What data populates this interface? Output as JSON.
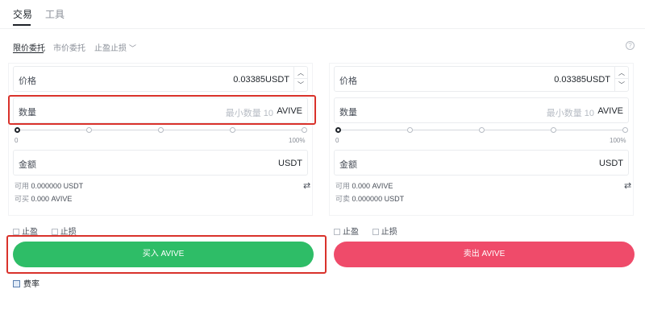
{
  "top_tabs": [
    {
      "label": "交易",
      "active": true
    },
    {
      "label": "工具",
      "active": false
    }
  ],
  "order_tabs": {
    "limit": "限价委托",
    "market": "市价委托",
    "tpsl": "止盈止损",
    "tpsl_chevron": "﹀",
    "help": "?"
  },
  "buy_panel": {
    "price_label": "价格",
    "price_value": "0.03385",
    "price_unit": "USDT",
    "qty_label": "数量",
    "qty_hint": "最小数量 10",
    "qty_unit": "AVIVE",
    "slider_min": "0",
    "slider_max": "100%",
    "slider_value": 0,
    "amount_label": "金额",
    "amount_unit": "USDT",
    "available_label": "可用",
    "available_value": "0.000000 USDT",
    "buyable_label": "可买",
    "buyable_value": "0.000 AVIVE"
  },
  "sell_panel": {
    "price_label": "价格",
    "price_value": "0.03385",
    "price_unit": "USDT",
    "qty_label": "数量",
    "qty_hint": "最小数量 10",
    "qty_unit": "AVIVE",
    "slider_min": "0",
    "slider_max": "100%",
    "slider_value": 0,
    "amount_label": "金额",
    "amount_unit": "USDT",
    "available_label": "可用",
    "available_value": "0.000 AVIVE",
    "sellable_label": "可卖",
    "sellable_value": "0.000000 USDT"
  },
  "tpsl": {
    "take_profit": "止盈",
    "stop_loss": "止损"
  },
  "buttons": {
    "buy": "买入 AVIVE",
    "sell": "卖出 AVIVE"
  },
  "bottom": {
    "label": "费率"
  },
  "colors": {
    "buy": "#2ebd67",
    "sell": "#ef4b6a",
    "annotation": "#d9322b"
  }
}
